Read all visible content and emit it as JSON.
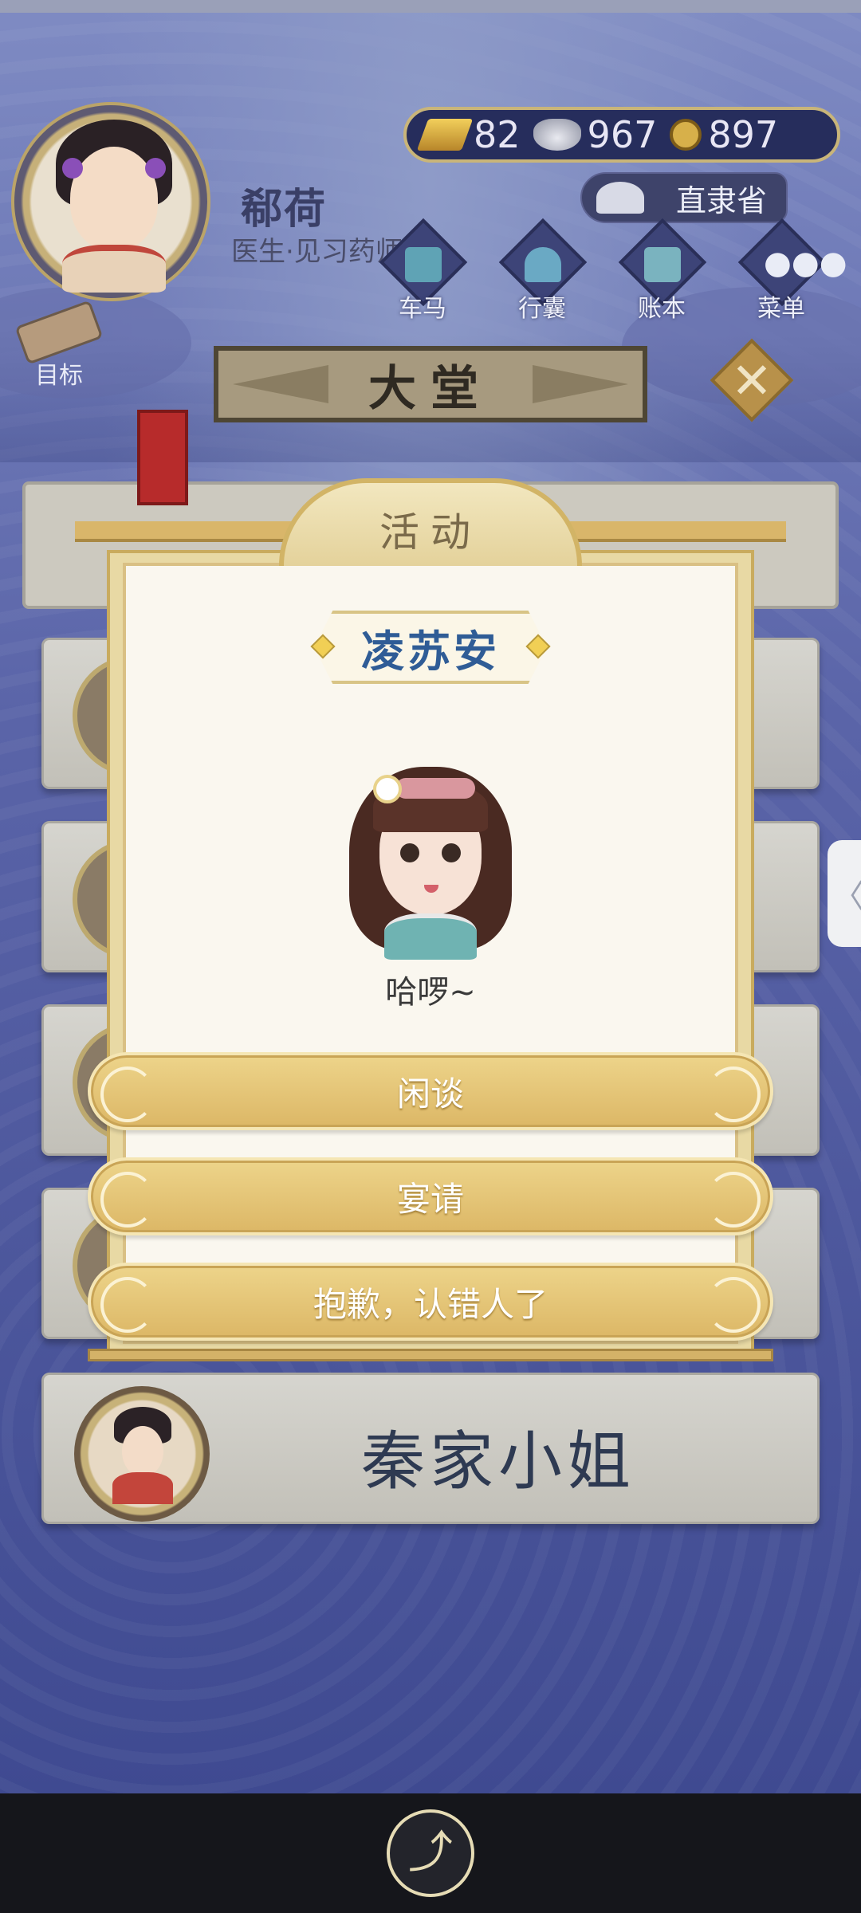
{
  "player": {
    "name": "郗荷",
    "role": "医生·见习药师"
  },
  "currency": {
    "gold": "82",
    "silver": "967",
    "coins": "897"
  },
  "location": {
    "label": "直隶省"
  },
  "menu": [
    {
      "label": "车马",
      "icon": "carriage-icon"
    },
    {
      "label": "行囊",
      "icon": "bag-icon"
    },
    {
      "label": "账本",
      "icon": "ledger-icon"
    },
    {
      "label": "菜单",
      "icon": "more-icon"
    }
  ],
  "goal": {
    "label": "目标"
  },
  "hall": {
    "title": "大堂"
  },
  "dialog": {
    "title": "活动",
    "npc_name": "凌苏安",
    "greeting": "哈啰~",
    "options": [
      "闲谈",
      "宴请",
      "抱歉，认错人了"
    ]
  },
  "background_card": {
    "name": "秦家小姐"
  },
  "side_tab": {
    "glyph": "〈"
  },
  "colors": {
    "npc_name": "#2f5c96",
    "option_gold": "#dcb766",
    "background_blue": "#4a5496"
  }
}
